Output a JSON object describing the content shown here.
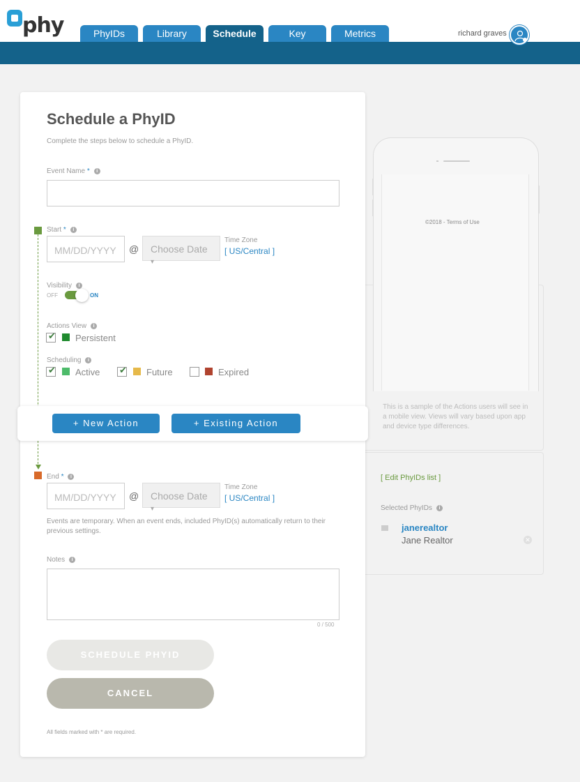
{
  "header": {
    "logo_text": "phy",
    "tabs": [
      {
        "label": "PhyIDs",
        "active": false
      },
      {
        "label": "Library",
        "active": false
      },
      {
        "label": "Schedule",
        "active": true
      },
      {
        "label": "Key",
        "active": false
      },
      {
        "label": "Metrics",
        "active": false
      }
    ],
    "user_name": "richard graves"
  },
  "form": {
    "title": "Schedule a PhyID",
    "subtitle": "Complete the steps below to schedule a PhyID.",
    "event_name_label": "Event Name",
    "required_mark": "*",
    "event_name_value": "",
    "start": {
      "label": "Start",
      "date_placeholder": "MM/DD/YYYY",
      "at": "@",
      "time_select": "Choose Date",
      "timezone_label": "Time Zone",
      "timezone_value": "[ US/Central ]"
    },
    "visibility": {
      "label": "Visibility",
      "off": "OFF",
      "on": "ON",
      "state": true
    },
    "actions_view": {
      "label": "Actions View",
      "options": [
        {
          "label": "Persistent",
          "checked": true,
          "color": "#1f8a2e"
        }
      ]
    },
    "scheduling": {
      "label": "Scheduling",
      "options": [
        {
          "label": "Active",
          "checked": true,
          "color": "#4dbb6a"
        },
        {
          "label": "Future",
          "checked": true,
          "color": "#e6b94a"
        },
        {
          "label": "Expired",
          "checked": false,
          "color": "#b0432f"
        }
      ]
    },
    "buttons": {
      "new_action": "+ New Action",
      "existing_action": "+ Existing Action"
    },
    "end": {
      "label": "End",
      "date_placeholder": "MM/DD/YYYY",
      "at": "@",
      "time_select": "Choose Date",
      "timezone_label": "Time Zone",
      "timezone_value": "[ US/Central ]"
    },
    "end_note": "Events are temporary. When an event ends, included PhyID(s) automatically return to their previous settings.",
    "notes_label": "Notes",
    "notes_counter": "0 / 500",
    "schedule_button": "SCHEDULE PHYID",
    "cancel_button": "CANCEL",
    "footnote": "All fields marked with * are required."
  },
  "preview": {
    "copyright": "©2018 - Terms of Use",
    "sample_text": "This is a sample of the Actions users will see in a mobile view. Views will vary based upon app and device type differences."
  },
  "phyids_panel": {
    "edit_link": "[ Edit PhyIDs list ]",
    "selected_label": "Selected PhyIDs",
    "items": [
      {
        "handle": "janerealtor",
        "name": "Jane Realtor"
      }
    ]
  },
  "colors": {
    "brand_blue": "#2a86c3",
    "header_dark": "#14628a",
    "start_green": "#6a9a3f",
    "end_orange": "#d86a2a"
  }
}
